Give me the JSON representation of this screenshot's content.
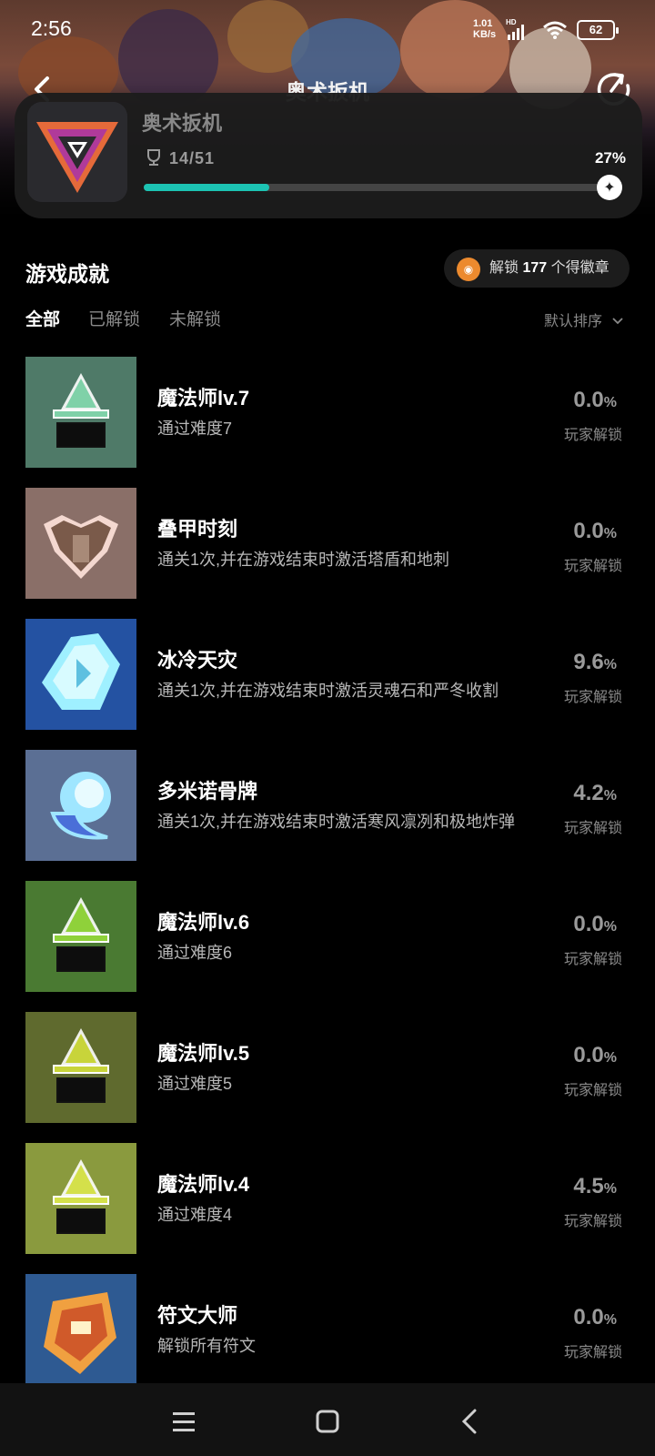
{
  "status": {
    "time": "2:56",
    "net_speed_top": "1.01",
    "net_speed_unit": "KB/s",
    "hd": "HD",
    "battery": "62"
  },
  "header": {
    "title": "奥术扳机"
  },
  "game": {
    "name": "奥术扳机",
    "progress_text": "14/51",
    "progress_percent": "27%",
    "progress_fraction": 0.27
  },
  "section": {
    "title": "游戏成就",
    "badge_prefix": "解锁",
    "badge_count": "177",
    "badge_suffix": "个得徽章"
  },
  "tabs": [
    {
      "label": "全部",
      "active": true
    },
    {
      "label": "已解锁",
      "active": false
    },
    {
      "label": "未解锁",
      "active": false
    }
  ],
  "sort": {
    "label": "默认排序"
  },
  "achievements": [
    {
      "name": "魔法师lv.7",
      "desc": "通过难度7",
      "pct": "0.0",
      "pct_unit": "%",
      "sub": "玩家解锁",
      "bg": "#4f7a68"
    },
    {
      "name": "叠甲时刻",
      "desc": "通关1次,并在游戏结束时激活塔盾和地刺",
      "pct": "0.0",
      "pct_unit": "%",
      "sub": "玩家解锁",
      "bg": "#8a6f68"
    },
    {
      "name": "冰冷天灾",
      "desc": "通关1次,并在游戏结束时激活灵魂石和严冬收割",
      "pct": "9.6",
      "pct_unit": "%",
      "sub": "玩家解锁",
      "bg": "#2452a2"
    },
    {
      "name": "多米诺骨牌",
      "desc": "通关1次,并在游戏结束时激活寒风凛冽和极地炸弹",
      "pct": "4.2",
      "pct_unit": "%",
      "sub": "玩家解锁",
      "bg": "#5b6f94"
    },
    {
      "name": "魔法师lv.6",
      "desc": "通过难度6",
      "pct": "0.0",
      "pct_unit": "%",
      "sub": "玩家解锁",
      "bg": "#4a7a32"
    },
    {
      "name": "魔法师lv.5",
      "desc": "通过难度5",
      "pct": "0.0",
      "pct_unit": "%",
      "sub": "玩家解锁",
      "bg": "#5f6a2e"
    },
    {
      "name": "魔法师lv.4",
      "desc": "通过难度4",
      "pct": "4.5",
      "pct_unit": "%",
      "sub": "玩家解锁",
      "bg": "#8a9a3e"
    },
    {
      "name": "符文大师",
      "desc": "解锁所有符文",
      "pct": "0.0",
      "pct_unit": "%",
      "sub": "玩家解锁",
      "bg": "#2e5a92"
    }
  ]
}
